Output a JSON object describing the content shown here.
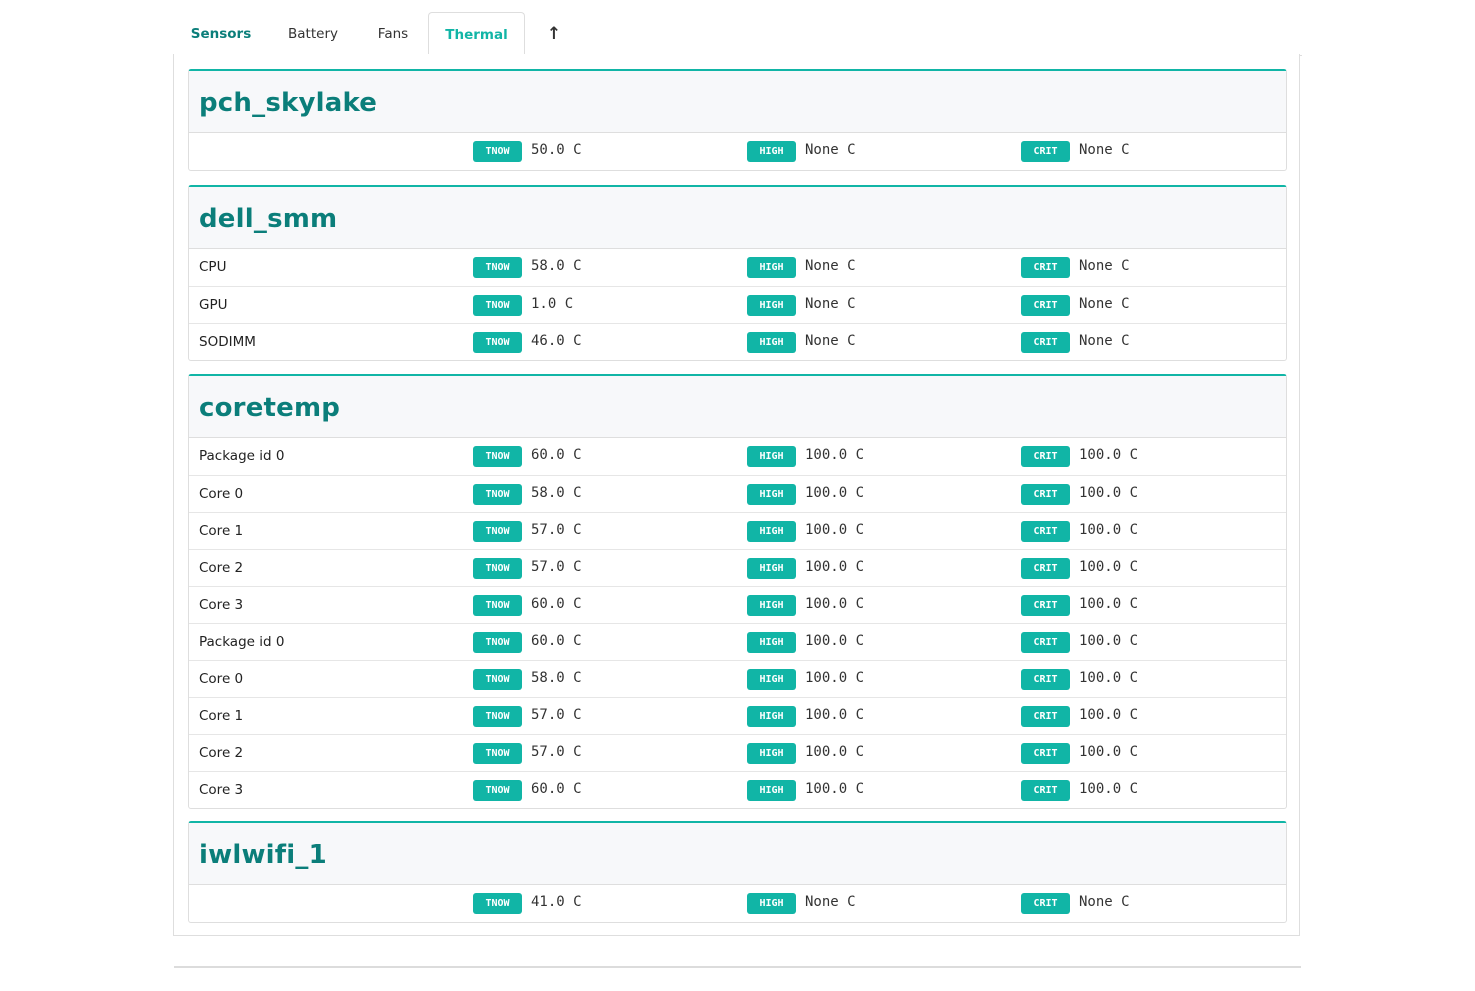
{
  "tabs": [
    {
      "label": "Sensors"
    },
    {
      "label": "Battery"
    },
    {
      "label": "Fans"
    },
    {
      "label": "Thermal"
    }
  ],
  "tab_icon": "arrow-up-icon",
  "badges": {
    "tnow": "TNOW",
    "high": "HIGH",
    "crit": "CRIT"
  },
  "colors": {
    "accent": "#11b5a6",
    "title": "#0b7e7a",
    "header_bg": "#f7f8fa"
  },
  "sections": [
    {
      "title": "pch_skylake",
      "rows": [
        {
          "label": "",
          "tnow": "50.0 C",
          "high": "None C",
          "crit": "None C"
        }
      ]
    },
    {
      "title": "dell_smm",
      "rows": [
        {
          "label": "CPU",
          "tnow": "58.0 C",
          "high": "None C",
          "crit": "None C"
        },
        {
          "label": "GPU",
          "tnow": "1.0 C",
          "high": "None C",
          "crit": "None C"
        },
        {
          "label": "SODIMM",
          "tnow": "46.0 C",
          "high": "None C",
          "crit": "None C"
        }
      ]
    },
    {
      "title": "coretemp",
      "rows": [
        {
          "label": "Package id 0",
          "tnow": "60.0 C",
          "high": "100.0 C",
          "crit": "100.0 C"
        },
        {
          "label": "Core 0",
          "tnow": "58.0 C",
          "high": "100.0 C",
          "crit": "100.0 C"
        },
        {
          "label": "Core 1",
          "tnow": "57.0 C",
          "high": "100.0 C",
          "crit": "100.0 C"
        },
        {
          "label": "Core 2",
          "tnow": "57.0 C",
          "high": "100.0 C",
          "crit": "100.0 C"
        },
        {
          "label": "Core 3",
          "tnow": "60.0 C",
          "high": "100.0 C",
          "crit": "100.0 C"
        },
        {
          "label": "Package id 0",
          "tnow": "60.0 C",
          "high": "100.0 C",
          "crit": "100.0 C"
        },
        {
          "label": "Core 0",
          "tnow": "58.0 C",
          "high": "100.0 C",
          "crit": "100.0 C"
        },
        {
          "label": "Core 1",
          "tnow": "57.0 C",
          "high": "100.0 C",
          "crit": "100.0 C"
        },
        {
          "label": "Core 2",
          "tnow": "57.0 C",
          "high": "100.0 C",
          "crit": "100.0 C"
        },
        {
          "label": "Core 3",
          "tnow": "60.0 C",
          "high": "100.0 C",
          "crit": "100.0 C"
        }
      ]
    },
    {
      "title": "iwlwifi_1",
      "rows": [
        {
          "label": "",
          "tnow": "41.0 C",
          "high": "None C",
          "crit": "None C"
        }
      ]
    }
  ]
}
